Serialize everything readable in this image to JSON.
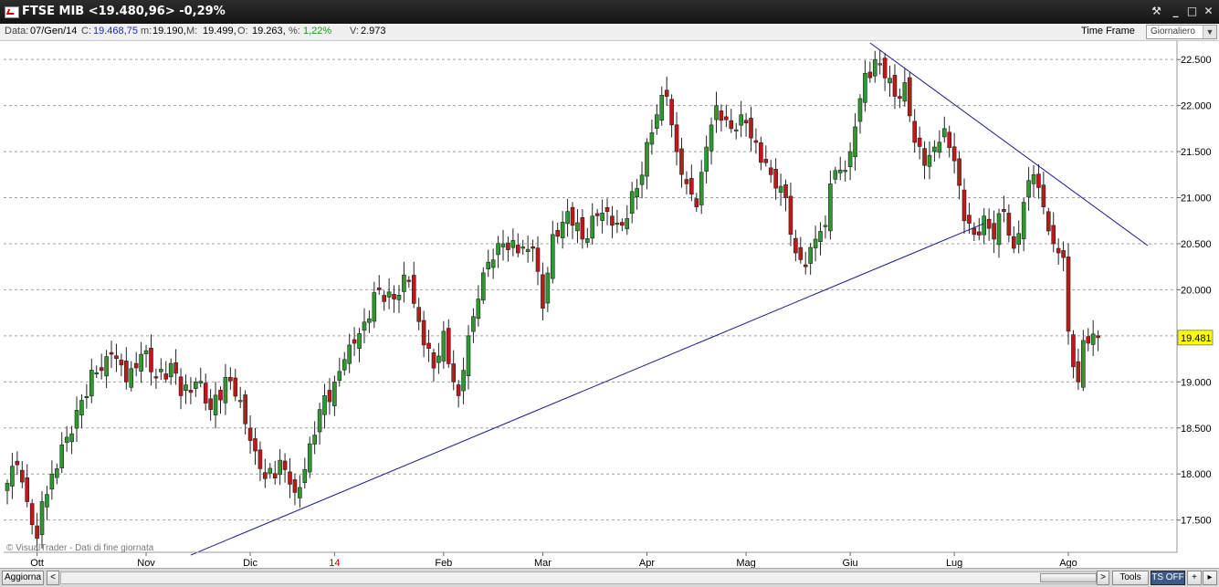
{
  "window": {
    "title": "FTSE MIB <19.480,96> -0,29%",
    "buttons": {
      "tools": "⚒",
      "minimize": "_",
      "maximize": "□",
      "close": "✕"
    }
  },
  "infobar": {
    "date_label": "Data:",
    "date": "07/Gen/14",
    "close_label": "C:",
    "close": "19.468,75",
    "min_label": "m:",
    "min": "19.190,",
    "max_label": "M:",
    "max": "19.499,",
    "open_label": "O:",
    "open": "19.263,",
    "pct_label": "%:",
    "pct": "1,22%",
    "vol_label": "V:",
    "vol": "2.973",
    "timeframe_label": "Time Frame",
    "timeframe_value": "Giornaliero"
  },
  "chart_data": {
    "type": "candlestick",
    "instrument": "FTSE MIB",
    "ylim": [
      17150,
      22700
    ],
    "yticks": [
      17500,
      18000,
      18500,
      19000,
      19500,
      20000,
      20500,
      21000,
      21500,
      22000,
      22500
    ],
    "ytick_labels": [
      "17.500",
      "18.000",
      "18.500",
      "19.000",
      "19.500",
      "20.000",
      "20.500",
      "21.000",
      "21.500",
      "22.000",
      "22.500"
    ],
    "xaxis_labels": [
      {
        "label": "Ott",
        "index": 6,
        "color": "#000000"
      },
      {
        "label": "Nov",
        "index": 28,
        "color": "#000000"
      },
      {
        "label": "Dic",
        "index": 49,
        "color": "#000000"
      },
      {
        "label": "14",
        "index": 66,
        "color": "#cc0000"
      },
      {
        "label": "Feb",
        "index": 88,
        "color": "#000000"
      },
      {
        "label": "Mar",
        "index": 108,
        "color": "#000000"
      },
      {
        "label": "Apr",
        "index": 129,
        "color": "#000000"
      },
      {
        "label": "Mag",
        "index": 149,
        "color": "#000000"
      },
      {
        "label": "Giu",
        "index": 170,
        "color": "#000000"
      },
      {
        "label": "Lug",
        "index": 191,
        "color": "#000000"
      },
      {
        "label": "Ago",
        "index": 214,
        "color": "#000000"
      }
    ],
    "last_price_label": "19.481",
    "last_price": 19481,
    "up_color": "#2e9a2e",
    "down_color": "#c01818",
    "trendline_color": "#1a1a8a",
    "trendlines": [
      {
        "from": {
          "index": 37,
          "price": 17120
        },
        "to": {
          "index": 197,
          "price": 20720
        }
      },
      {
        "from": {
          "index": 174,
          "price": 22680
        },
        "to": {
          "index": 230,
          "price": 20480
        }
      }
    ],
    "key_closes": [
      [
        0,
        17900
      ],
      [
        2,
        18100
      ],
      [
        4,
        17700
      ],
      [
        6,
        17300
      ],
      [
        7,
        17700
      ],
      [
        9,
        18000
      ],
      [
        12,
        18400
      ],
      [
        15,
        18800
      ],
      [
        18,
        19100
      ],
      [
        21,
        19300
      ],
      [
        24,
        19000
      ],
      [
        27,
        19300
      ],
      [
        30,
        19050
      ],
      [
        33,
        19200
      ],
      [
        35,
        18850
      ],
      [
        38,
        19000
      ],
      [
        41,
        18700
      ],
      [
        44,
        19050
      ],
      [
        47,
        18800
      ],
      [
        50,
        18250
      ],
      [
        52,
        17950
      ],
      [
        55,
        18150
      ],
      [
        58,
        17800
      ],
      [
        60,
        18050
      ],
      [
        63,
        18700
      ],
      [
        66,
        19000
      ],
      [
        69,
        19400
      ],
      [
        72,
        19650
      ],
      [
        75,
        20000
      ],
      [
        78,
        19900
      ],
      [
        81,
        20100
      ],
      [
        84,
        19400
      ],
      [
        86,
        19150
      ],
      [
        88,
        19550
      ],
      [
        90,
        19000
      ],
      [
        91,
        18850
      ],
      [
        93,
        19500
      ],
      [
        95,
        19900
      ],
      [
        97,
        20300
      ],
      [
        100,
        20500
      ],
      [
        103,
        20400
      ],
      [
        106,
        20450
      ],
      [
        108,
        19800
      ],
      [
        110,
        20600
      ],
      [
        113,
        20850
      ],
      [
        116,
        20550
      ],
      [
        118,
        20800
      ],
      [
        121,
        20850
      ],
      [
        124,
        20700
      ],
      [
        127,
        21100
      ],
      [
        129,
        21600
      ],
      [
        131,
        21900
      ],
      [
        133,
        22100
      ],
      [
        135,
        21500
      ],
      [
        137,
        21150
      ],
      [
        139,
        20900
      ],
      [
        141,
        21550
      ],
      [
        143,
        22000
      ],
      [
        146,
        21750
      ],
      [
        148,
        21900
      ],
      [
        151,
        21600
      ],
      [
        154,
        21250
      ],
      [
        157,
        21000
      ],
      [
        159,
        20400
      ],
      [
        161,
        20250
      ],
      [
        163,
        20550
      ],
      [
        165,
        20700
      ],
      [
        166,
        21150
      ],
      [
        168,
        21300
      ],
      [
        170,
        21500
      ],
      [
        173,
        22350
      ],
      [
        175,
        22500
      ],
      [
        177,
        22300
      ],
      [
        179,
        22100
      ],
      [
        181,
        22250
      ],
      [
        183,
        21600
      ],
      [
        185,
        21350
      ],
      [
        187,
        21550
      ],
      [
        189,
        21750
      ],
      [
        191,
        21400
      ],
      [
        193,
        20750
      ],
      [
        195,
        20600
      ],
      [
        197,
        20800
      ],
      [
        199,
        20550
      ],
      [
        201,
        20850
      ],
      [
        203,
        20450
      ],
      [
        205,
        20950
      ],
      [
        207,
        21250
      ],
      [
        209,
        20900
      ],
      [
        211,
        20500
      ],
      [
        213,
        20350
      ],
      [
        214,
        19550
      ],
      [
        216,
        19000
      ],
      [
        217,
        19450
      ],
      [
        219,
        19520
      ],
      [
        220,
        19480
      ]
    ]
  },
  "chart_footer": "© VisualTrader - Dati di fine giornata",
  "bottombar": {
    "refresh_label": "Aggiorna",
    "scroll_left": "<",
    "scroll_right": ">",
    "tools_label": "Tools",
    "tsoff_label": "TS OFF",
    "plus_label": "+",
    "menu_label": "▸"
  }
}
